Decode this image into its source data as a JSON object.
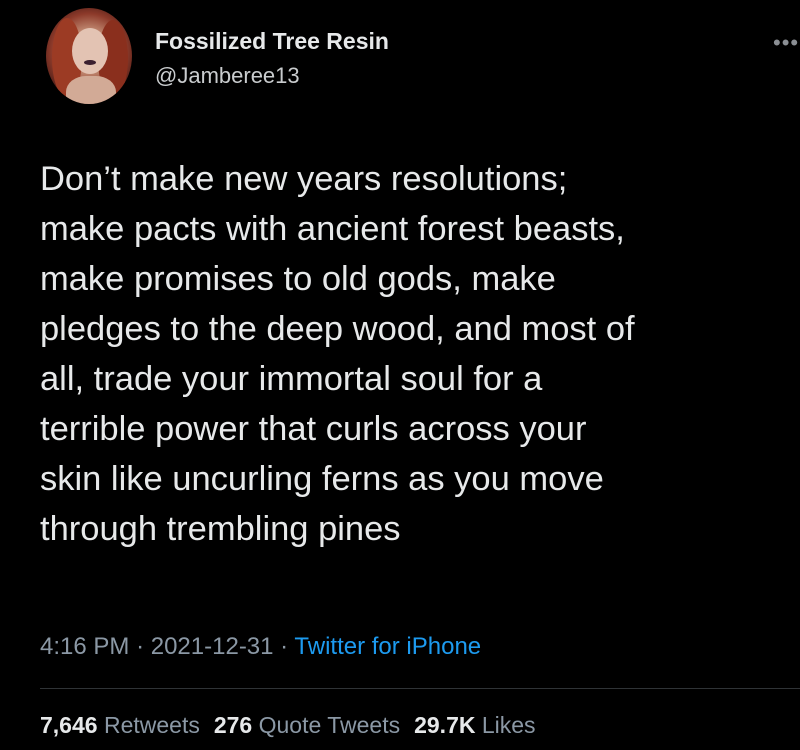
{
  "tweet": {
    "author": {
      "display_name": "Fossilized Tree Resin",
      "handle": "@Jamberee13",
      "avatar_icon": "profile-photo"
    },
    "more_icon": "ellipsis-icon",
    "text": "Don’t make new years resolutions;\nmake pacts with ancient forest beasts,\nmake promises to old gods, make\npledges to the deep wood, and most of\nall, trade your immortal soul for a\nterrible power that curls across your\nskin like uncurling ferns as you move\nthrough trembling pines",
    "meta": {
      "time": "4:16 PM",
      "separator": "·",
      "date": "2021-12-31",
      "source": "Twitter for iPhone"
    },
    "stats": {
      "retweets": {
        "count": "7,646",
        "label": "Retweets"
      },
      "quote_tweets": {
        "count": "276",
        "label": "Quote Tweets"
      },
      "likes": {
        "count": "29.7K",
        "label": "Likes"
      }
    }
  },
  "colors": {
    "background": "#000000",
    "text_primary": "#e7e9ea",
    "text_secondary": "#8b98a5",
    "link": "#1d9bf0",
    "divider": "#2f3336"
  }
}
